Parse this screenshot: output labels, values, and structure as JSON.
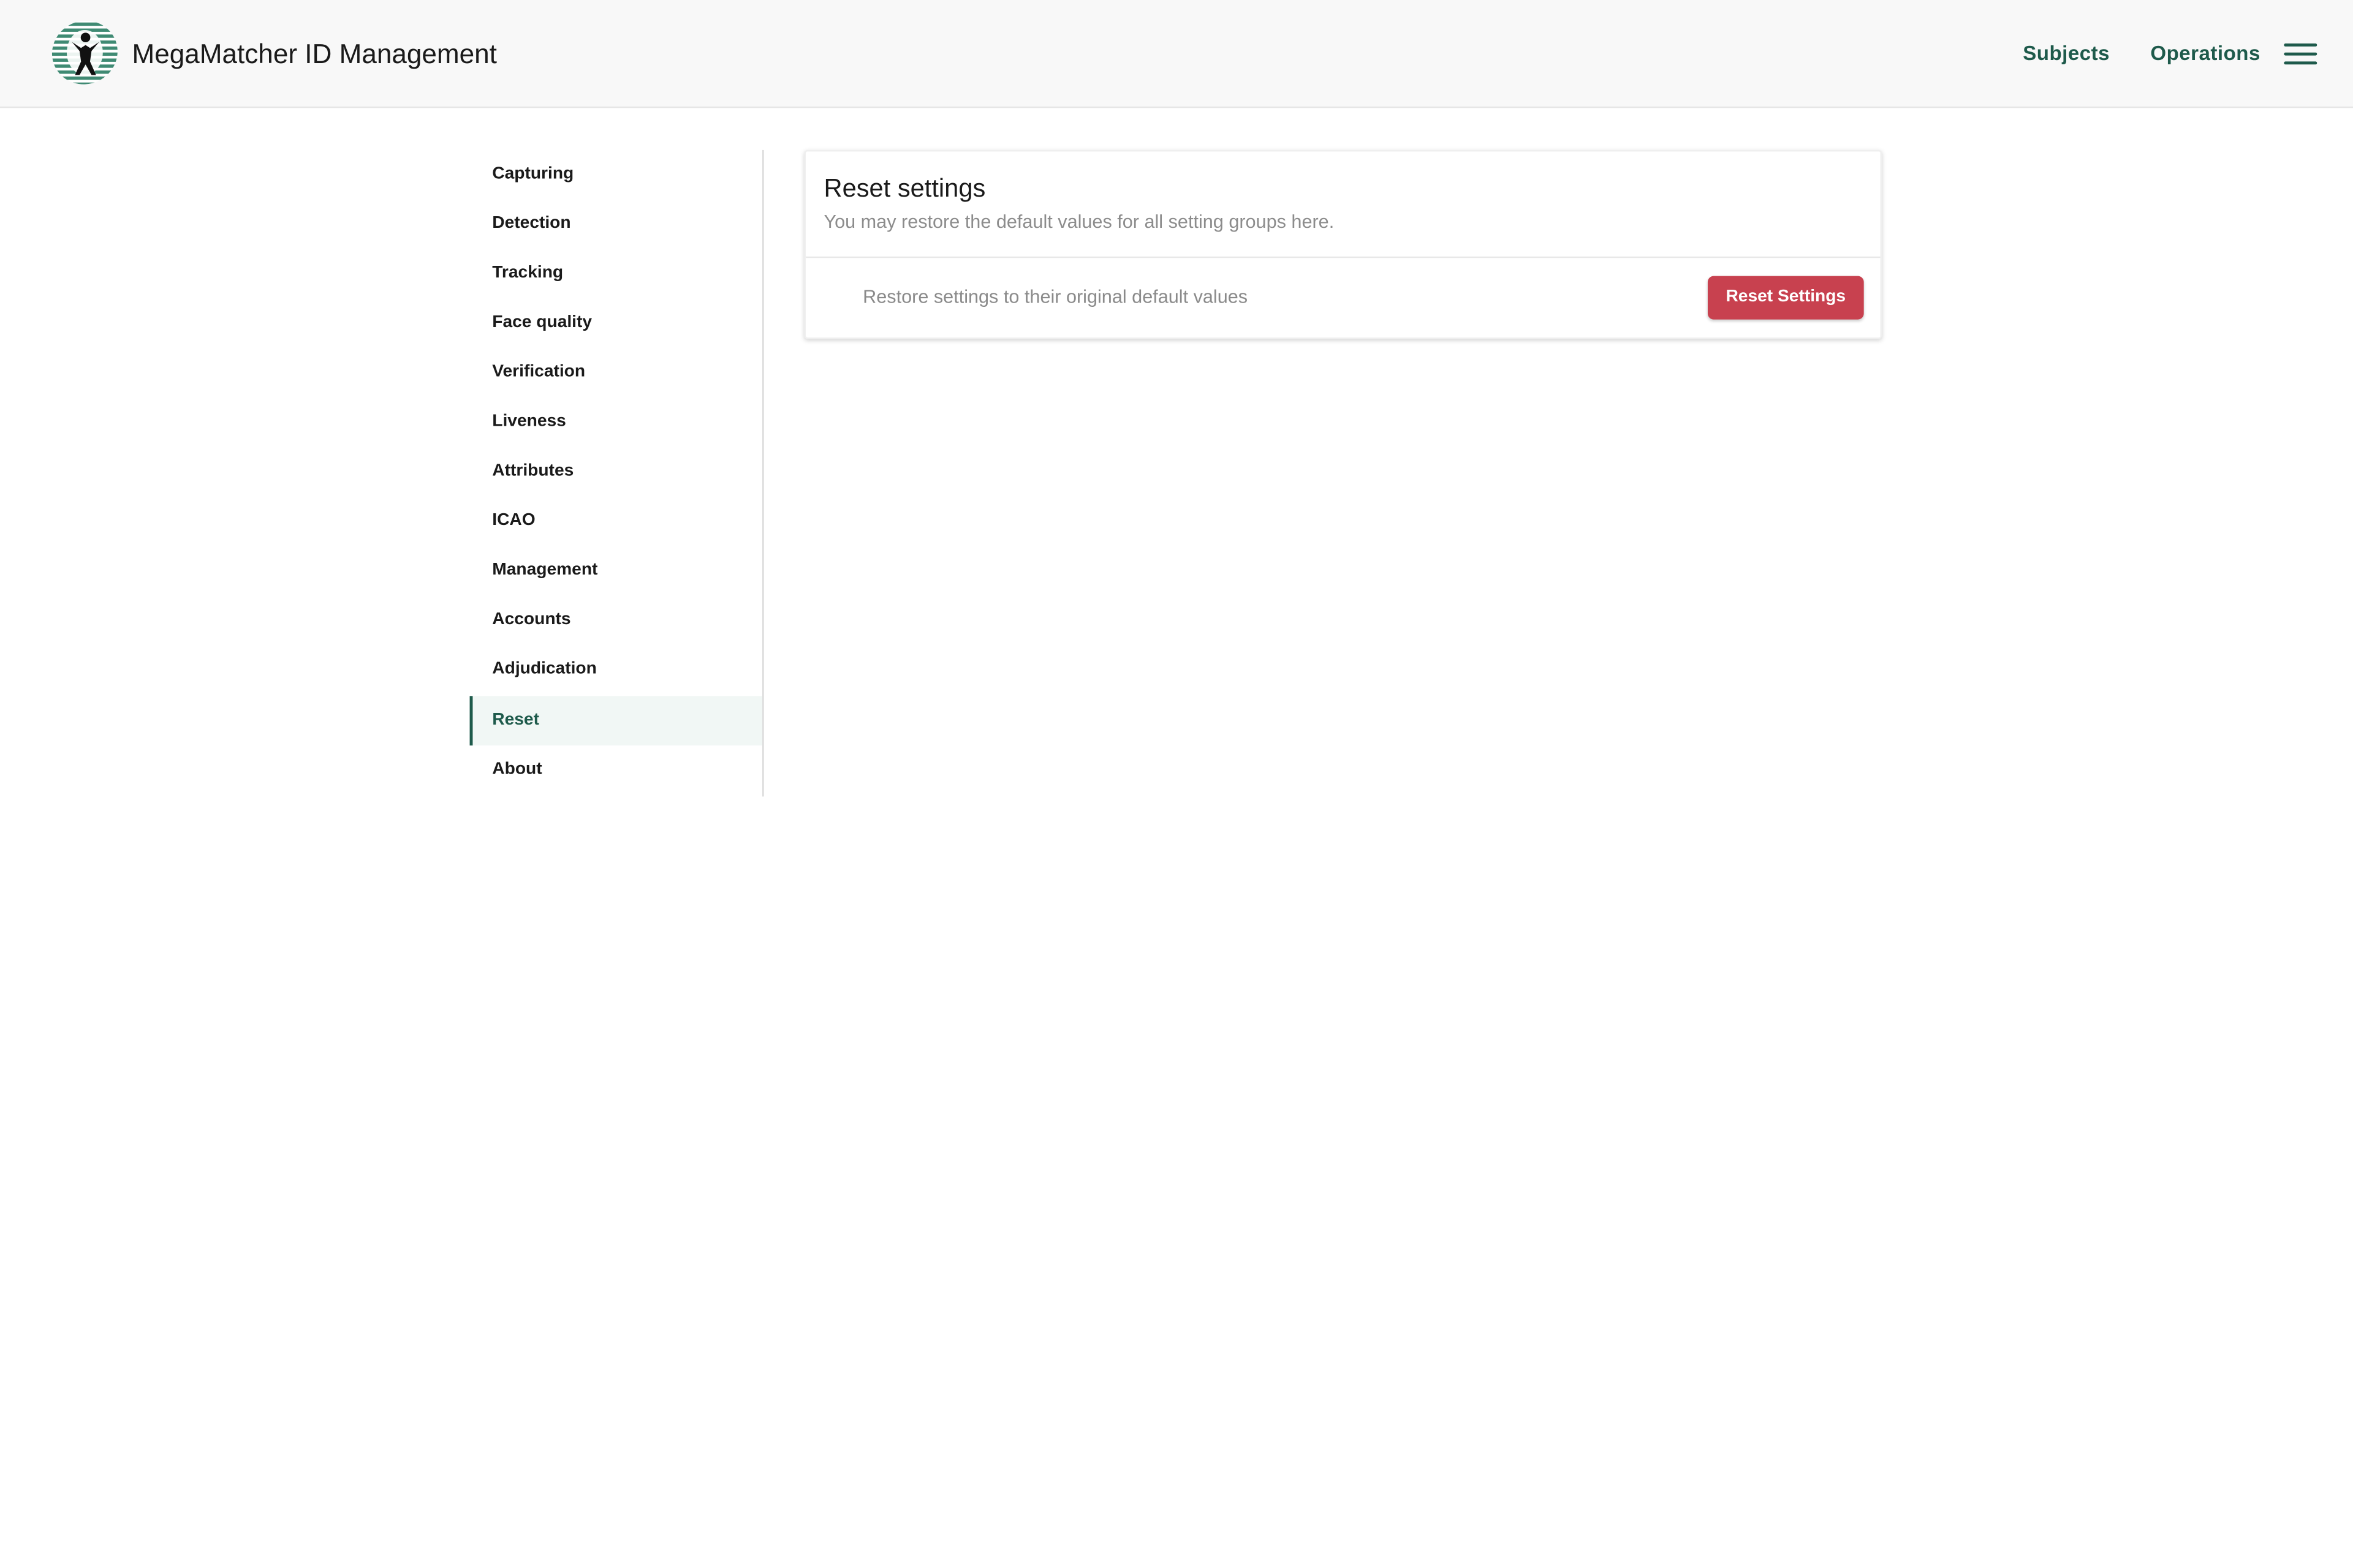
{
  "header": {
    "app_title": "MegaMatcher ID Management",
    "logo_icon": "biometric-person-oval-logo",
    "nav": [
      {
        "label": "Subjects"
      },
      {
        "label": "Operations"
      }
    ],
    "menu_icon": "hamburger-menu-icon"
  },
  "sidebar": {
    "active_index": 11,
    "items": [
      {
        "label": "Capturing"
      },
      {
        "label": "Detection"
      },
      {
        "label": "Tracking"
      },
      {
        "label": "Face quality"
      },
      {
        "label": "Verification"
      },
      {
        "label": "Liveness"
      },
      {
        "label": "Attributes"
      },
      {
        "label": "ICAO"
      },
      {
        "label": "Management"
      },
      {
        "label": "Accounts"
      },
      {
        "label": "Adjudication"
      },
      {
        "label": "Reset"
      },
      {
        "label": "About"
      }
    ]
  },
  "card": {
    "title": "Reset settings",
    "subtitle": "You may restore the default values for all setting groups here.",
    "row_text": "Restore settings to their original default values",
    "button_label": "Reset Settings"
  },
  "colors": {
    "accent": "#1e5a4b",
    "danger": "#c8414f",
    "header_bg": "#f8f8f8",
    "active_bg": "#f1f7f5"
  }
}
